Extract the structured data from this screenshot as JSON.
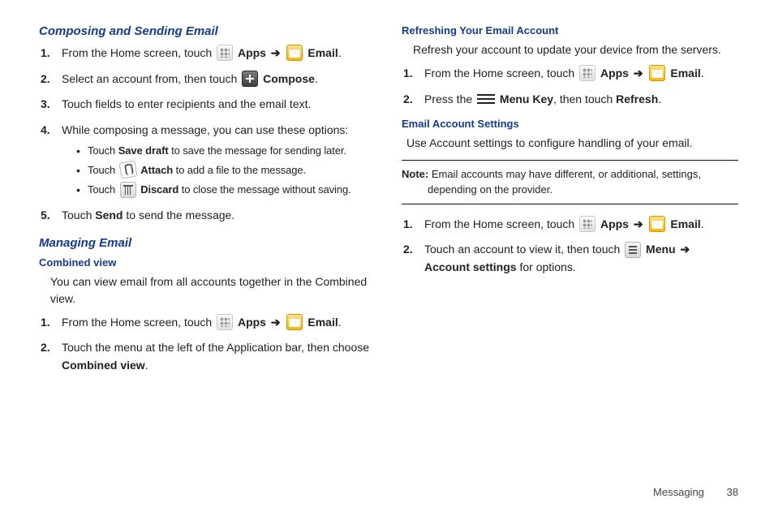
{
  "left": {
    "h_compose": "Composing and Sending Email",
    "compose_steps": {
      "s1a": "From the Home screen, touch ",
      "s1_apps": "Apps",
      "s1_email": "Email",
      "s2a": "Select an account from, then touch ",
      "s2_compose": "Compose",
      "s3": "Touch fields to enter recipients and the email text.",
      "s4": "While composing a message, you can use these options:",
      "b1a": "Touch ",
      "b1_bold": "Save draft",
      "b1b": " to save the message for sending later.",
      "b2a": "Touch ",
      "b2_bold": "Attach",
      "b2b": " to add a file to the message.",
      "b3a": "Touch ",
      "b3_bold": "Discard",
      "b3b": " to close the message without saving.",
      "s5a": "Touch ",
      "s5_bold": "Send",
      "s5b": " to send the message."
    },
    "h_manage": "Managing Email",
    "h_combined": "Combined view",
    "combined_intro": "You can view email from all accounts together in the Combined view.",
    "combined_steps": {
      "s1a": "From the Home screen, touch ",
      "s1_apps": "Apps",
      "s1_email": "Email",
      "s2a": "Touch the menu at the left of the Application bar, then choose ",
      "s2_bold": "Combined view"
    }
  },
  "right": {
    "h_refresh": "Refreshing Your Email Account",
    "refresh_intro": "Refresh your account to update your device from the servers.",
    "refresh_steps": {
      "s1a": "From the Home screen, touch ",
      "s1_apps": "Apps",
      "s1_email": "Email",
      "s2a": "Press the ",
      "s2_bold": "Menu Key",
      "s2b": ", then touch ",
      "s2_bold2": "Refresh"
    },
    "h_settings": "Email Account Settings",
    "settings_intro": "Use Account settings to configure handling of your email.",
    "note_label": "Note:",
    "note_text": " Email accounts may have different, or additional, settings, depending on the provider.",
    "settings_steps": {
      "s1a": "From the Home screen, touch ",
      "s1_apps": "Apps",
      "s1_email": "Email",
      "s2a": "Touch an account to view it, then touch ",
      "s2_menu": "Menu",
      "s2_bold": "Account settings",
      "s2b": " for options."
    }
  },
  "footer": {
    "section": "Messaging",
    "page": "38"
  },
  "glyphs": {
    "arrow": "➔",
    "period": "."
  },
  "nums": {
    "n1": "1.",
    "n2": "2.",
    "n3": "3.",
    "n4": "4.",
    "n5": "5."
  }
}
